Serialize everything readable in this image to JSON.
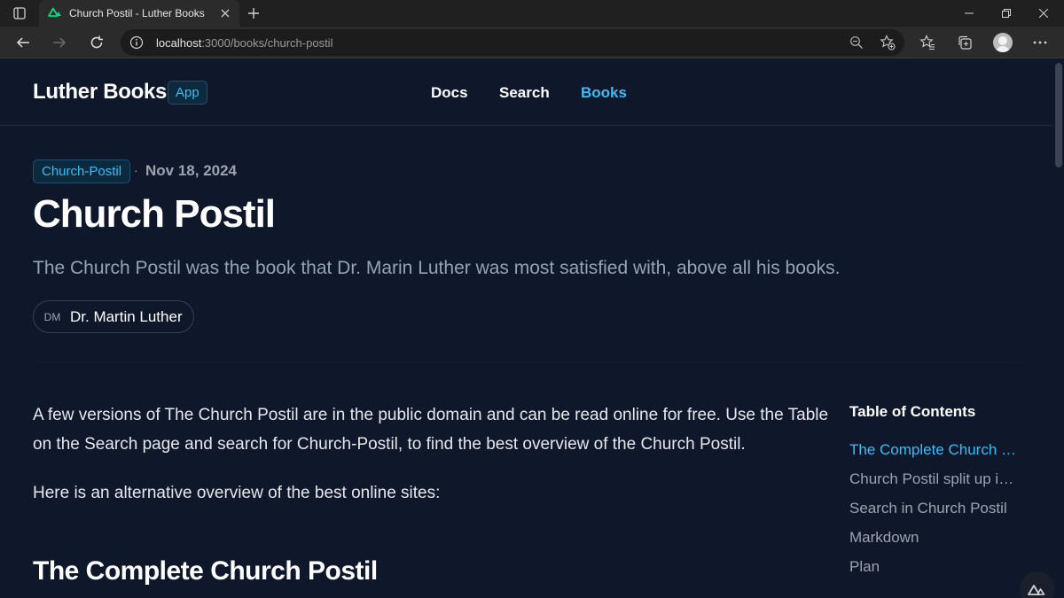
{
  "browser": {
    "tab_title": "Church Postil - Luther Books",
    "url_host": "localhost",
    "url_rest": ":3000/books/church-postil"
  },
  "header": {
    "logo": "Luther Books",
    "badge": "App",
    "nav": [
      "Docs",
      "Search",
      "Books"
    ],
    "active_nav": "Books"
  },
  "article": {
    "tag": "Church-Postil",
    "date": "Nov 18, 2024",
    "title": "Church Postil",
    "description": "The Church Postil was the book that Dr. Marin Luther was most satisfied with, above all his books.",
    "author_initials": "DM",
    "author_name": "Dr. Martin Luther",
    "paragraphs": [
      "A few versions of The Church Postil are in the public domain and can be read online for free. Use the Table on the Search page and search for Church-Postil, to find the best overview of the Church Postil.",
      "Here is an alternative overview of the best online sites:"
    ],
    "heading": "The Complete Church Postil"
  },
  "toc": {
    "title": "Table of Contents",
    "items": [
      "The Complete Church Postil",
      "Church Postil split up in volumes",
      "Search in Church Postil",
      "Markdown",
      "Plan"
    ]
  },
  "colors": {
    "background": "#0f172a",
    "accent": "#38bdf8",
    "muted": "#94a3b8"
  }
}
